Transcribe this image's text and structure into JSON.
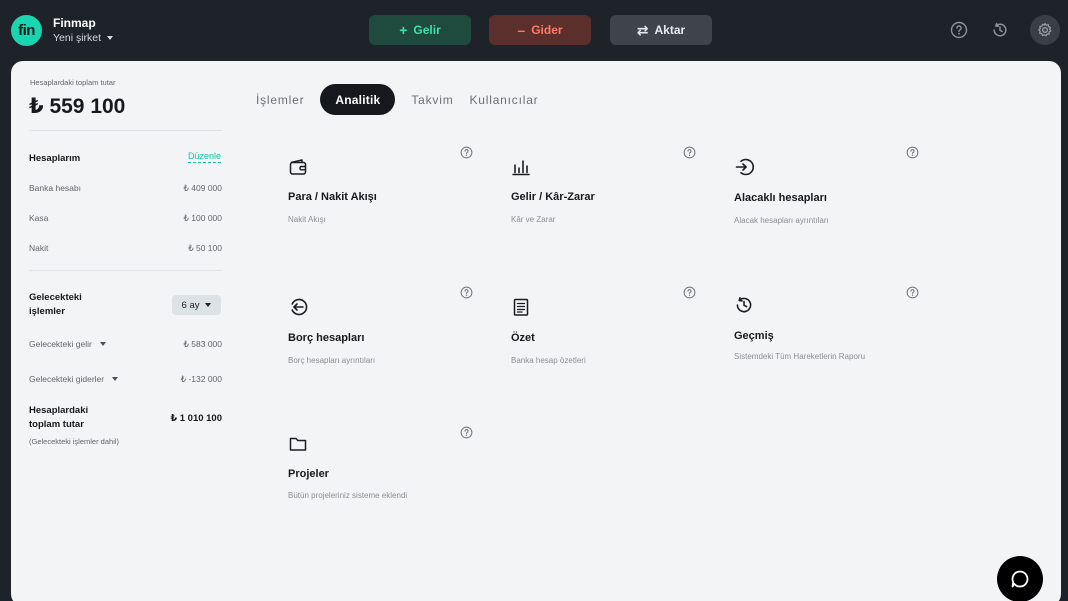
{
  "header": {
    "logo_text": "fin",
    "brand": "Finmap",
    "company": "Yeni şirket",
    "buttons": {
      "income": {
        "glyph": "+",
        "label": "Gelir"
      },
      "expense": {
        "glyph": "–",
        "label": "Gider"
      },
      "transfer": {
        "glyph": "⇄",
        "label": "Aktar"
      }
    },
    "icons": [
      "help-icon",
      "history-icon",
      "gear-icon"
    ]
  },
  "sidebar": {
    "total_label": "Hesaplardaki toplam tutar",
    "total_value": "₺ 559 100",
    "accounts": {
      "title": "Hesaplarım",
      "edit_label": "Düzenle",
      "items": [
        {
          "label": "Banka hesabı",
          "value": "₺ 409 000"
        },
        {
          "label": "Kasa",
          "value": "₺ 100 000"
        },
        {
          "label": "Nakit",
          "value": "₺ 50 100"
        }
      ]
    },
    "future": {
      "title_line1": "Gelecekteki",
      "title_line2": "işlemler",
      "period": "6 ay",
      "income_label": "Gelecekteki gelir",
      "income_value": "₺ 583 000",
      "expense_label": "Gelecekteki giderler",
      "expense_value": "₺ -132 000"
    },
    "grand": {
      "line1": "Hesaplardaki",
      "line2": "toplam tutar",
      "value": "₺ 1 010 100",
      "note": "(Gelecekteki işlemler dahil)"
    }
  },
  "tabs": [
    "İşlemler",
    "Analitik",
    "Takvim",
    "Kullanıcılar"
  ],
  "active_tab": "Analitik",
  "reports": [
    {
      "title": "Para / Nakit Akışı",
      "desc": "Nakit Akışı",
      "icon": "wallet-icon"
    },
    {
      "title": "Gelir / Kâr-Zarar",
      "desc": "Kâr ve Zarar",
      "icon": "bar-chart-icon"
    },
    {
      "title": "Alacaklı hesapları",
      "desc": "Alacak hesapları ayrıntıları",
      "icon": "arrow-in-icon"
    },
    {
      "title": "Borç hesapları",
      "desc": "Borç hesapları ayrıntıları",
      "icon": "arrow-out-icon"
    },
    {
      "title": "Özet",
      "desc": "Banka hesap özetleri",
      "icon": "document-icon"
    },
    {
      "title": "Geçmiş",
      "desc": "Sistemdeki Tüm Hareketlerin Raporu",
      "icon": "history-icon"
    },
    {
      "title": "Projeler",
      "desc": "Bütün projeleriniz sisteme eklendi",
      "icon": "folder-icon"
    }
  ],
  "colors": {
    "accent": "#19d6b0",
    "income": "#3ce0a8",
    "expense": "#ff7a6a",
    "topbar": "#1e2329",
    "panel": "#f3f4f5"
  }
}
